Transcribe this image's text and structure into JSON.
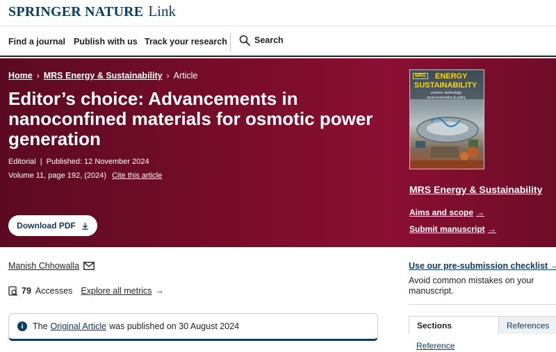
{
  "brand": {
    "name": "SPRINGER NATURE",
    "product": "Link"
  },
  "nav": {
    "find_journal": "Find a journal",
    "publish": "Publish with us",
    "track": "Track your research",
    "search": "Search"
  },
  "breadcrumb": {
    "home": "Home",
    "journal": "MRS Energy & Sustainability",
    "current": "Article"
  },
  "article": {
    "title": "Editor’s choice: Advancements in nanoconfined materials for osmotic power generation",
    "type": "Editorial",
    "published": "Published: 12 November 2024",
    "volume": "Volume 11, page 192, (2024)",
    "cite": "Cite this article",
    "download": "Download PDF"
  },
  "cover": {
    "logo": "MRS",
    "title_line1": "ENERGY",
    "title_line2": "SUSTAINABILITY",
    "sub_line1": "science, technology",
    "sub_line2": "socio-economics & policy"
  },
  "sidebar": {
    "journal_name": "MRS Energy & Sustainability",
    "aims": "Aims and scope",
    "submit": "Submit manuscript",
    "checklist": "Use our pre-submission checklist",
    "checklist_desc": "Avoid common mistakes on your manuscript.",
    "tabs": [
      "Sections",
      "References"
    ],
    "section_links": [
      "Reference"
    ]
  },
  "author": {
    "name": "Manish Chhowalla"
  },
  "metrics": {
    "count": "79",
    "label": "Accesses",
    "explore": "Explore all metrics"
  },
  "notice": {
    "prefix": "The",
    "link": "Original Article",
    "suffix": "was published on 30 August 2024"
  },
  "colors": {
    "hero": "#7a0d2b",
    "brand": "#0b3a63",
    "cover_accent": "#ffd800"
  }
}
